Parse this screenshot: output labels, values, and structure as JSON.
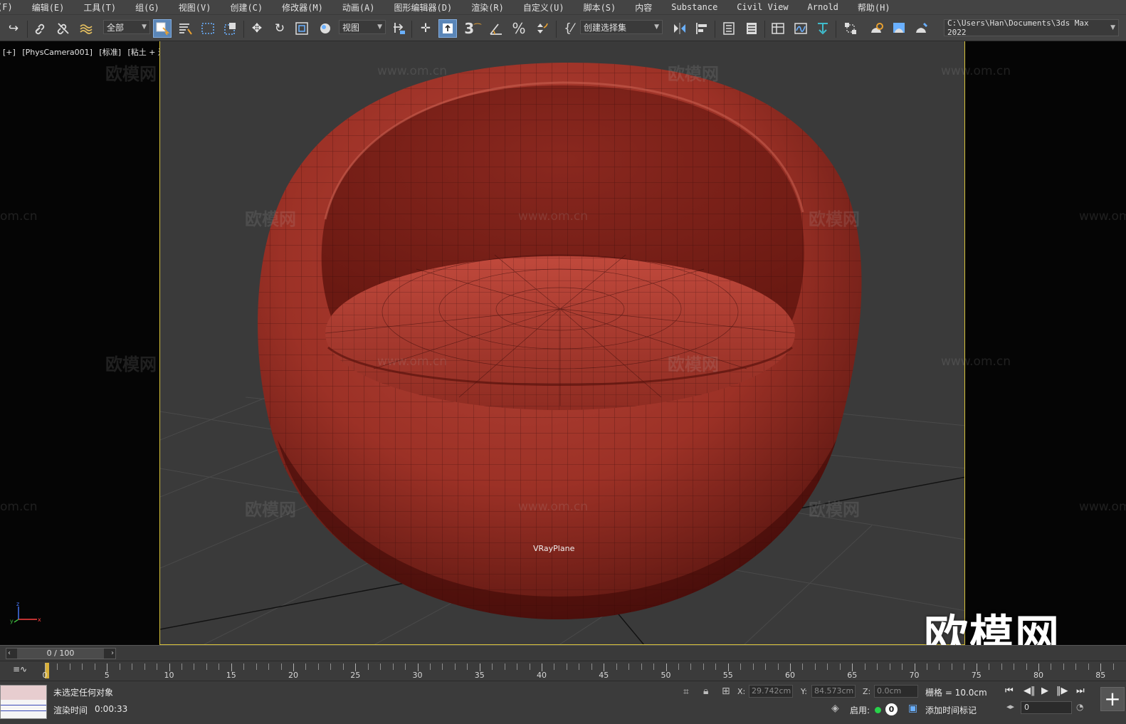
{
  "menu": [
    "(F)",
    "编辑(E)",
    "工具(T)",
    "组(G)",
    "视图(V)",
    "创建(C)",
    "修改器(M)",
    "动画(A)",
    "图形编辑器(D)",
    "渲染(R)",
    "自定义(U)",
    "脚本(S)",
    "内容",
    "Substance",
    "Civil View",
    "Arnold",
    "帮助(H)"
  ],
  "toolbar": {
    "selection_filter": "全部",
    "ref_coord": "视图",
    "named_selection": "创建选择集",
    "project_path": "C:\\Users\\Han\\Documents\\3ds Max 2022"
  },
  "viewport": {
    "label_plus": "[+]",
    "label_camera": "[PhysCamera001]",
    "label_mode": "[标准]",
    "label_shading": "[粘土 + 边面]",
    "object_label": "VRayPlane",
    "watermark_cn": "欧模网",
    "watermark_url": "www.om.cn",
    "watermark_url_short": "om.cn",
    "brand_logo": "欧模网",
    "accent_color": "#d6c13a"
  },
  "timeslider": {
    "value": "0 / 100"
  },
  "trackbar": {
    "labels": [
      "0",
      "5",
      "10",
      "15",
      "20",
      "25",
      "30",
      "35",
      "40",
      "45",
      "50",
      "55",
      "60",
      "65",
      "70",
      "75",
      "80",
      "85"
    ]
  },
  "status": {
    "message": "未选定任何对象",
    "render_time_label": "渲染时间",
    "render_time": "0:00:33",
    "x_label": "X:",
    "x_value": "29.742cm",
    "y_label": "Y:",
    "y_value": "84.573cm",
    "z_label": "Z:",
    "z_value": "0.0cm",
    "grid": "栅格 = 10.0cm",
    "enable_label": "启用:",
    "enable_count": "0",
    "add_time_tag": "添加时间标记",
    "frame_value": "0"
  },
  "icons": {
    "redo": "redo-icon",
    "link": "link-icon",
    "unlink": "unlink-icon",
    "bind": "bind-spacewarp-icon",
    "select": "select-object-icon",
    "select_by_name": "select-by-name-icon",
    "rect_region": "rectangular-region-icon",
    "window_crossing": "window-crossing-icon",
    "move": "move-icon",
    "rotate": "rotate-icon",
    "scale": "scale-icon",
    "placement": "placement-icon",
    "pivot": "pivot-icon",
    "keyboard_shortcut": "keyboard-shortcut-icon",
    "snap3d": "snap-3d-icon",
    "angle_snap": "angle-snap-icon",
    "percent_snap": "percent-snap-icon",
    "spinner_snap": "spinner-snap-icon",
    "edit_named": "edit-named-selection-icon",
    "mirror": "mirror-icon",
    "align": "align-icon",
    "layer": "layer-explorer-icon",
    "ribbon": "ribbon-icon",
    "scene_explorer": "scene-explorer-icon",
    "curve_editor": "curve-editor-icon",
    "schematic": "schematic-view-icon",
    "material": "material-editor-icon",
    "render_setup": "render-setup-icon",
    "rendered_frame": "rendered-frame-window-icon",
    "render": "render-production-icon"
  }
}
